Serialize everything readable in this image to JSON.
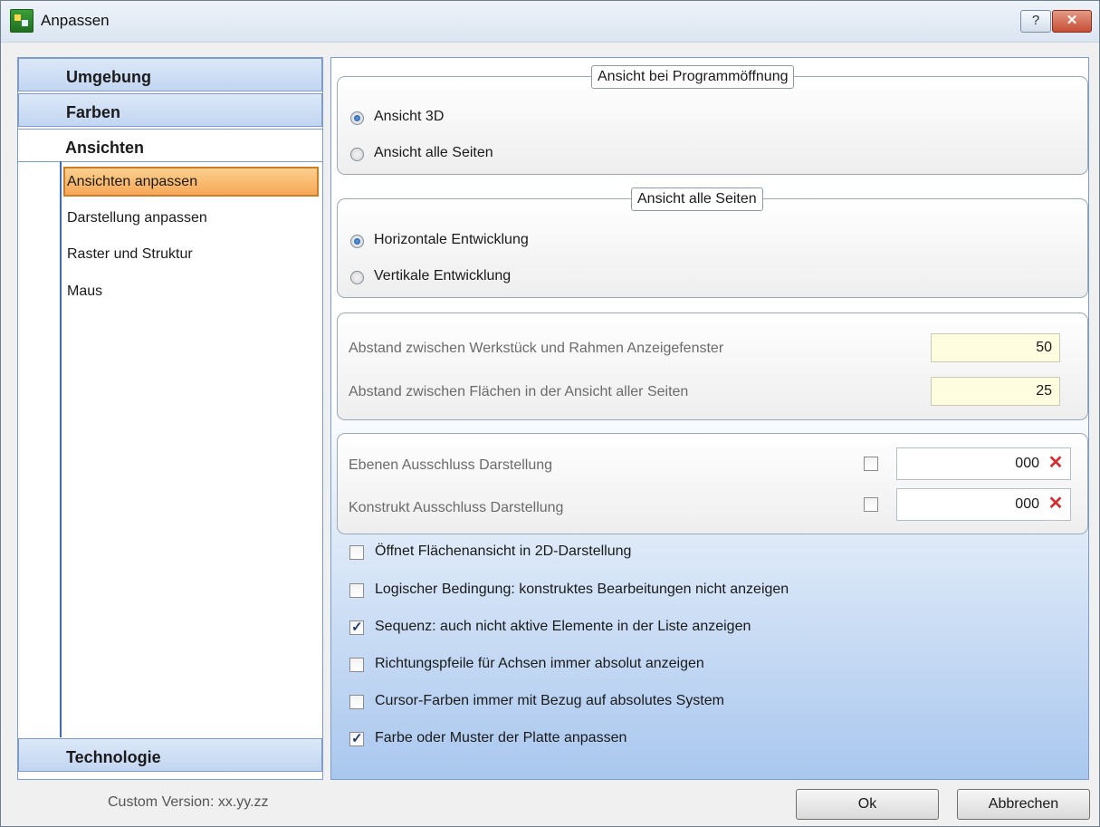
{
  "window": {
    "title": "Anpassen",
    "help_label": "?",
    "close_label": "✕"
  },
  "sidebar": {
    "sections": [
      {
        "label": "Umgebung"
      },
      {
        "label": "Farben"
      },
      {
        "label": "Ansichten"
      },
      {
        "label": "Technologie"
      }
    ],
    "subitems": [
      {
        "label": "Ansichten anpassen",
        "selected": true
      },
      {
        "label": "Darstellung anpassen"
      },
      {
        "label": "Raster und Struktur"
      },
      {
        "label": "Maus"
      }
    ]
  },
  "panel": {
    "group1": {
      "title": "Ansicht bei Programmöffnung",
      "options": [
        {
          "label": "Ansicht 3D",
          "selected": true
        },
        {
          "label": "Ansicht alle Seiten",
          "selected": false
        }
      ]
    },
    "group2": {
      "title": "Ansicht alle Seiten",
      "options": [
        {
          "label": "Horizontale Entwicklung",
          "selected": true
        },
        {
          "label": "Vertikale Entwicklung",
          "selected": false
        }
      ]
    },
    "distances": [
      {
        "label": "Abstand zwischen Werkstück und Rahmen Anzeigefenster",
        "value": "50"
      },
      {
        "label": "Abstand zwischen Flächen in der Ansicht aller Seiten",
        "value": "25"
      }
    ],
    "exclusions": [
      {
        "label": "Ebenen Ausschluss Darstellung",
        "checked": false,
        "value": "000"
      },
      {
        "label": "Konstrukt Ausschluss Darstellung",
        "checked": false,
        "value": "000"
      }
    ],
    "checkboxes": [
      {
        "label": "Öffnet Flächenansicht in 2D-Darstellung",
        "checked": false
      },
      {
        "label": "Logischer Bedingung: konstruktes Bearbeitungen nicht anzeigen",
        "checked": false
      },
      {
        "label": "Sequenz: auch nicht aktive Elemente in der Liste anzeigen",
        "checked": true
      },
      {
        "label": "Richtungspfeile für Achsen immer absolut anzeigen",
        "checked": false
      },
      {
        "label": "Cursor-Farben immer mit Bezug auf absolutes System",
        "checked": false
      },
      {
        "label": "Farbe oder Muster der Platte anpassen",
        "checked": true
      }
    ]
  },
  "footer": {
    "version": "Custom Version: xx.yy.zz",
    "ok_label": "Ok",
    "cancel_label": "Abbrechen"
  },
  "colors": {
    "accent": "#7a9cd3",
    "selection": "#f6a857",
    "field_bg": "#fffde0",
    "clear_icon": "#d42d2d"
  }
}
